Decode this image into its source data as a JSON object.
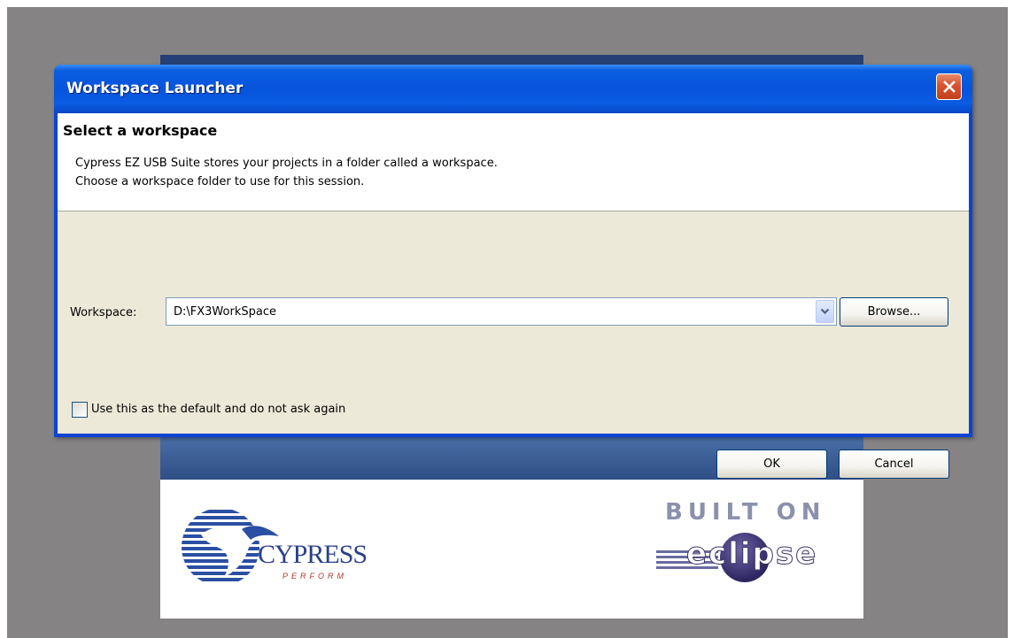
{
  "dialog": {
    "title": "Workspace Launcher",
    "header_title": "Select a workspace",
    "description_line1": "Cypress EZ USB Suite stores your projects in a folder called a workspace.",
    "description_line2": "Choose a workspace folder to use for this session."
  },
  "workspace": {
    "label": "Workspace:",
    "value": "D:\\FX3WorkSpace",
    "browse_label": "Browse..."
  },
  "default_checkbox": {
    "label": "Use this as the default and do not ask again",
    "checked": false
  },
  "buttons": {
    "ok_label": "OK",
    "cancel_label": "Cancel"
  },
  "splash": {
    "cypress_name": "CYPRESS",
    "cypress_tagline": "PERFORM",
    "built_on_text": "BUILT ON",
    "eclipse_name": "eclipse"
  },
  "icons": {
    "close": "close-icon",
    "dropdown": "chevron-down-icon",
    "cypress_logo": "cypress-logo-icon",
    "eclipse_logo": "eclipse-logo-icon"
  },
  "colors": {
    "titlebar": "#0754dd",
    "close_button": "#d8522c",
    "dialog_body": "#ece9d8",
    "backdrop": "#858384"
  }
}
